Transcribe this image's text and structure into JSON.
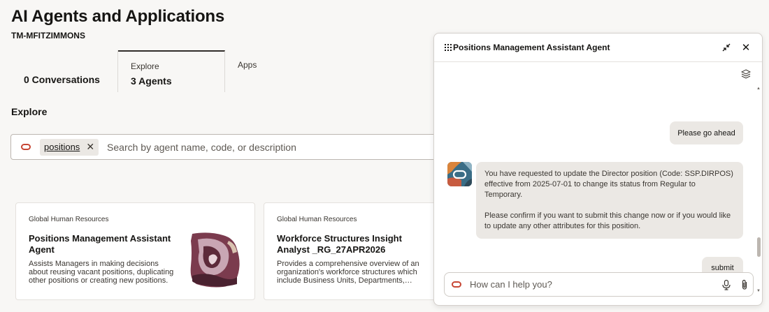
{
  "header": {
    "title": "AI Agents and Applications",
    "user_id": "TM-MFITZIMMONS"
  },
  "tabs": [
    {
      "label": "",
      "value": "0 Conversations"
    },
    {
      "label": "Explore",
      "value": "3 Agents"
    },
    {
      "label": "Apps",
      "value": ""
    }
  ],
  "explore": {
    "section_title": "Explore",
    "search": {
      "chip": "positions",
      "placeholder": "Search by agent name, code, or description"
    }
  },
  "cards": [
    {
      "category": "Global Human Resources",
      "title": "Positions Management Assistant Agent",
      "description": "Assists Managers in making decisions about reusing vacant positions, duplicating other positions or creating new positions."
    },
    {
      "category": "Global Human Resources",
      "title": "Workforce Structures Insight Analyst _RG_27APR2026",
      "description": "Provides a comprehensive overview of an organization's workforce structures which include Business Units, Departments,…"
    }
  ],
  "chat": {
    "title": "Positions Management Assistant Agent",
    "messages": [
      {
        "role": "user",
        "text": "Please go ahead"
      },
      {
        "role": "agent",
        "paragraphs": [
          "You have requested to update the Director position (Code: SSP.DIRPOS) effective from 2025-07-01 to change its status from Regular to Temporary.",
          "Please confirm if you want to submit this change now or if you would like to update any other attributes for this position."
        ]
      },
      {
        "role": "user",
        "text": "submit"
      }
    ],
    "input_placeholder": "How can I help you?"
  },
  "colors": {
    "accent": "#c74634",
    "background": "#f8f7f5",
    "bubble": "#ebe8e4"
  }
}
